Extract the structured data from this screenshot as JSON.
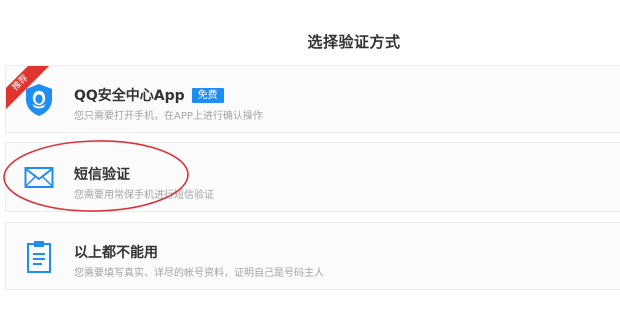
{
  "page": {
    "title": "选择验证方式"
  },
  "options": [
    {
      "title": "QQ安全中心App",
      "badge": "免费",
      "ribbon": "推荐",
      "description": "您只需要打开手机，在APP上进行确认操作",
      "icon": "shield-penguin-icon"
    },
    {
      "title": "短信验证",
      "description": "您需要用常保手机进行短信验证",
      "icon": "envelope-icon"
    },
    {
      "title": "以上都不能用",
      "description": "您需要填写真实、详尽的帐号资料，证明自己是号码主人",
      "icon": "clipboard-icon"
    }
  ],
  "colors": {
    "accent": "#1e8ef2",
    "ribbon": "#e0352f",
    "annotation": "#d9343a",
    "title_text": "#333333",
    "desc_text": "#a3a3a3"
  }
}
